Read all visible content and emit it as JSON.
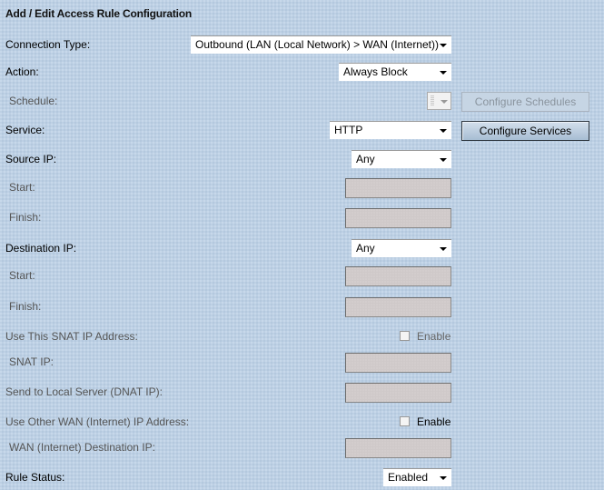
{
  "title": "Add / Edit Access Rule Configuration",
  "fields": {
    "connection_type": {
      "label": "Connection Type:",
      "value": "Outbound (LAN (Local Network) > WAN (Internet))"
    },
    "action": {
      "label": "Action:",
      "value": "Always Block"
    },
    "schedule": {
      "label": "Schedule:",
      "value": "",
      "button": "Configure Schedules"
    },
    "service": {
      "label": "Service:",
      "value": "HTTP",
      "button": "Configure Services"
    },
    "source_ip": {
      "label": "Source IP:",
      "value": "Any",
      "start_label": "Start:",
      "start_value": "",
      "finish_label": "Finish:",
      "finish_value": ""
    },
    "destination_ip": {
      "label": "Destination IP:",
      "value": "Any",
      "start_label": "Start:",
      "start_value": "",
      "finish_label": "Finish:",
      "finish_value": ""
    },
    "snat": {
      "label": "Use This SNAT IP Address:",
      "checkbox_label": "Enable",
      "checked": false,
      "ip_label": "SNAT IP:",
      "ip_value": ""
    },
    "dnat": {
      "label": "Send to Local Server (DNAT IP):",
      "value": ""
    },
    "other_wan": {
      "label": "Use Other WAN (Internet) IP Address:",
      "checkbox_label": "Enable",
      "checked": false,
      "dest_label": "WAN (Internet) Destination IP:",
      "dest_value": ""
    },
    "rule_status": {
      "label": "Rule Status:",
      "value": "Enabled"
    }
  }
}
